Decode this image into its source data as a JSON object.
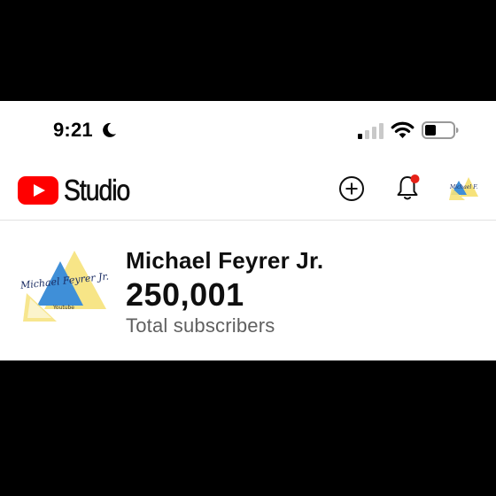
{
  "status_bar": {
    "time": "9:21",
    "icons": [
      "moon-icon",
      "cellular-signal-icon",
      "wifi-icon",
      "battery-icon"
    ]
  },
  "header": {
    "logo_text": "Studio",
    "logo_icon": "youtube-play-icon",
    "actions": [
      {
        "name": "create",
        "icon": "plus-circle-icon"
      },
      {
        "name": "notifications",
        "icon": "bell-icon",
        "has_badge": true
      },
      {
        "name": "account",
        "icon": "avatar-icon"
      }
    ]
  },
  "channel": {
    "name": "Michael Feyrer Jr.",
    "subscriber_count": "250,001",
    "subscriber_label": "Total subscribers",
    "avatar_text": "Michael Feyrer Jr.",
    "avatar_subtext": "Youtube"
  },
  "colors": {
    "brand_red": "#ff0000",
    "badge_red": "#e62117",
    "text_primary": "#0f0f0f",
    "text_secondary": "#606060",
    "avatar_blue": "#3f8fd8",
    "avatar_yellow": "#f6e27a"
  }
}
